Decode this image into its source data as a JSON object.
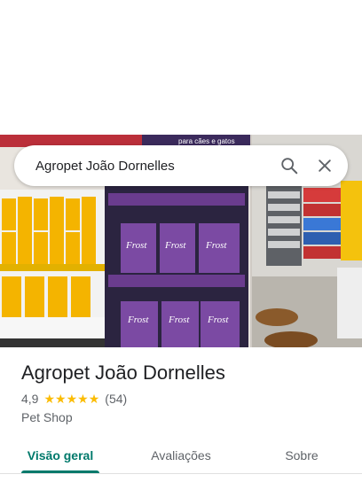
{
  "search": {
    "query": "Agropet João Dornelles"
  },
  "place": {
    "name": "Agropet João Dornelles",
    "rating": "4,9",
    "stars": 5,
    "review_count": "(54)",
    "category": "Pet Shop"
  },
  "tabs": [
    {
      "label": "Visão geral",
      "active": true
    },
    {
      "label": "Avaliações",
      "active": false
    },
    {
      "label": "Sobre",
      "active": false
    }
  ],
  "photo_text": {
    "brand": "Frost",
    "banner": "para cães e gatos"
  },
  "colors": {
    "accent": "#00796b",
    "star": "#fbbc04"
  }
}
